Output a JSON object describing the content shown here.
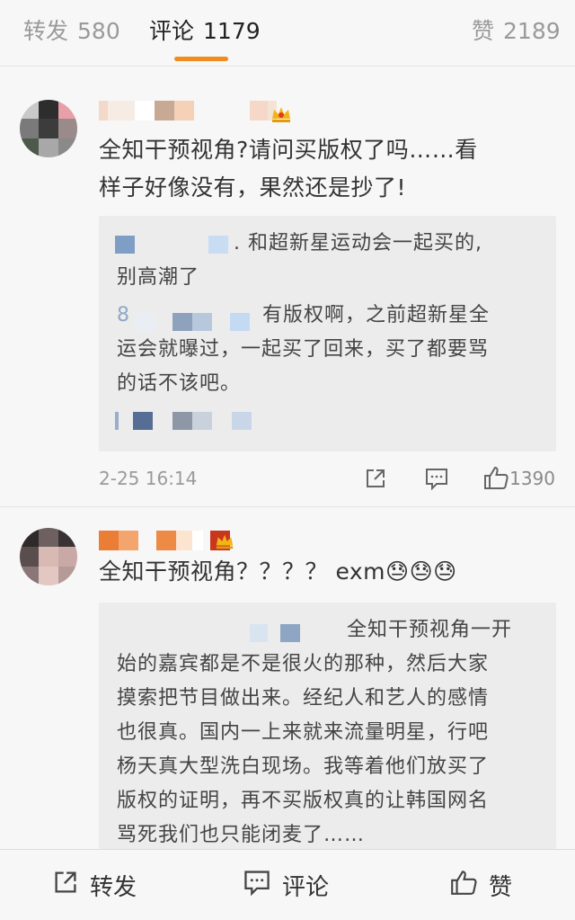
{
  "tabs": [
    {
      "label": "转发",
      "count": "580"
    },
    {
      "label": "评论",
      "count": "1179"
    },
    {
      "label": "赞",
      "count": "2189"
    }
  ],
  "comments": [
    {
      "text_line1": "全知干预视角?请问买版权了吗……看",
      "text_line2": "样子好像没有，果然还是抄了!",
      "replies": [
        {
          "line1": ". 和超新星运动会一起买的,",
          "line2": "别高潮了"
        },
        {
          "line1": "有版权啊，之前超新星全",
          "line2": "运会就曝过，一起买了回来，买了都要骂",
          "line3": "的话不该吧。",
          "prefix": "8"
        }
      ],
      "time": "2-25 16:14",
      "likes": "1390"
    },
    {
      "text": "全知干预视角？？？？ exm😓😓😓",
      "reply_lines": [
        "全知干预视角一开",
        "始的嘉宾都是不是很火的那种，然后大家",
        "摸索把节目做出来。经纪人和艺人的感情",
        "也很真。国内一上来就来流量明星，行吧",
        "杨天真大型洗白现场。我等着他们放买了",
        "版权的证明，再不买版权真的让韩国网名",
        "骂死我们也只能闭麦了……"
      ]
    }
  ],
  "bottom_bar": {
    "repost_label": "转发",
    "comment_label": "评论",
    "like_label": "赞"
  },
  "colors": {
    "accent": "#f08b1e",
    "background": "#f7f7f7",
    "reply_bg": "#ececec"
  },
  "icons": [
    "share-icon",
    "comment-icon",
    "thumbs-up-icon",
    "vip-crown-icon"
  ]
}
